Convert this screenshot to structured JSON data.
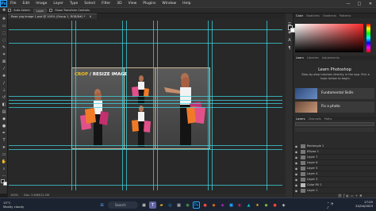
{
  "app": {
    "logo": "Ps"
  },
  "menu": [
    "File",
    "Edit",
    "Image",
    "Layer",
    "Type",
    "Select",
    "Filter",
    "3D",
    "View",
    "Plugins",
    "Window",
    "Help"
  ],
  "window_controls": [
    "—",
    "□",
    "✕"
  ],
  "options_bar": {
    "auto_select": "Auto-Select:",
    "layer_dropdown": "Layer",
    "transform_controls": "Show Transform Controls"
  },
  "document_tab": "Rose ysg image 1.psd @ 100% (Group 1, RGB/8#) *",
  "canvas": {
    "title_crop": "CROP",
    "title_sep": " / ",
    "title_resize": "RESIZE IMAGE"
  },
  "status": {
    "zoom": "100%",
    "info": "Doc: 2.64M/12.2M"
  },
  "color_panel": {
    "tabs": [
      "Color",
      "Swatches",
      "Gradients",
      "Patterns"
    ],
    "accent": "#ff2a2a"
  },
  "learn_panel": {
    "tabs": [
      "Learn",
      "Libraries",
      "Adjustments"
    ],
    "title": "Learn Photoshop",
    "subtitle": "Step-by-step tutorials directly in the app. Pick a topic below to begin.",
    "cards": [
      {
        "label": "Fundamental Skills"
      },
      {
        "label": "Fix a photo"
      }
    ]
  },
  "layers_panel": {
    "tabs": [
      "Layers",
      "Channels",
      "Paths"
    ],
    "layers": [
      "Rectangle 1",
      "Ellipse 1",
      "Layer 7",
      "Layer 6",
      "Layer 5",
      "Layer 4",
      "Layer 3",
      "Color Fill 1",
      "Layer 1"
    ]
  },
  "taskbar": {
    "weather_temp": "15°C",
    "weather_desc": "Mostly cloudy",
    "search_placeholder": "Search",
    "time": "17:25",
    "date": "22/04/2023"
  }
}
